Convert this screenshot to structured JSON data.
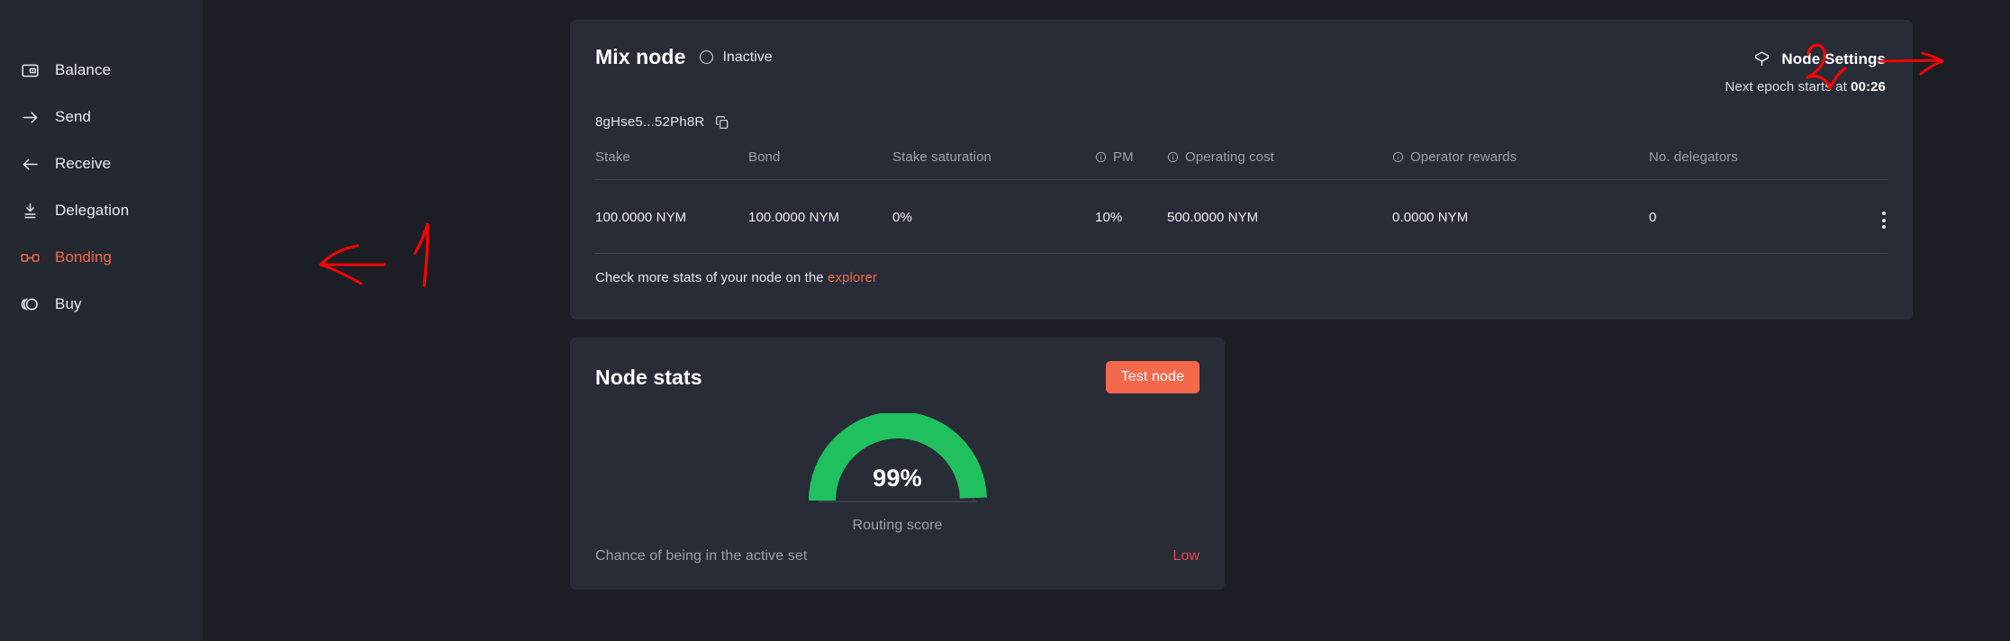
{
  "sidebar": {
    "items": [
      {
        "label": "Balance",
        "icon": "wallet-icon",
        "active": false
      },
      {
        "label": "Send",
        "icon": "arrow-right-icon",
        "active": false
      },
      {
        "label": "Receive",
        "icon": "arrow-left-icon",
        "active": false
      },
      {
        "label": "Delegation",
        "icon": "download-icon",
        "active": false
      },
      {
        "label": "Bonding",
        "icon": "link-icon",
        "active": true
      },
      {
        "label": "Buy",
        "icon": "coin-icon",
        "active": false
      }
    ]
  },
  "node_card": {
    "title": "Mix node",
    "status": "Inactive",
    "node_id": "8gHse5...52Ph8R",
    "copy_icon": "copy-icon",
    "settings": {
      "label": "Node Settings",
      "icon": "cube-icon"
    },
    "epoch": {
      "prefix": "Next epoch starts at ",
      "time": "00:26"
    },
    "table": {
      "columns": [
        {
          "label": "Stake",
          "info": false
        },
        {
          "label": "Bond",
          "info": false
        },
        {
          "label": "Stake saturation",
          "info": false
        },
        {
          "label": "PM",
          "info": true
        },
        {
          "label": "Operating cost",
          "info": true
        },
        {
          "label": "Operator rewards",
          "info": true
        },
        {
          "label": "No. delegators",
          "info": false
        }
      ],
      "rows": [
        {
          "stake": "100.0000 NYM",
          "bond": "100.0000 NYM",
          "stake_saturation": "0%",
          "pm": "10%",
          "operating_cost": "500.0000 NYM",
          "operator_rewards": "0.0000 NYM",
          "no_delegators": "0",
          "actions_icon": "kebab-menu-icon"
        }
      ]
    },
    "footer": {
      "text": "Check more stats of your node on the ",
      "link": "explorer"
    }
  },
  "stats_card": {
    "title": "Node stats",
    "test_button": "Test node",
    "gauge": {
      "value": "99%",
      "percent": 99,
      "caption": "Routing score",
      "color": "#21c05f"
    },
    "chance": {
      "label": "Chance of being in the active set",
      "value": "Low",
      "color": "#f0455b"
    }
  },
  "annotations": {
    "marker_one": "1",
    "marker_two": "2",
    "color": "#ff0000"
  },
  "theme": {
    "accent": "#f4684c",
    "sidebar_bg": "#242831",
    "main_bg": "#1b1e25",
    "card_bg": "#282c36"
  }
}
